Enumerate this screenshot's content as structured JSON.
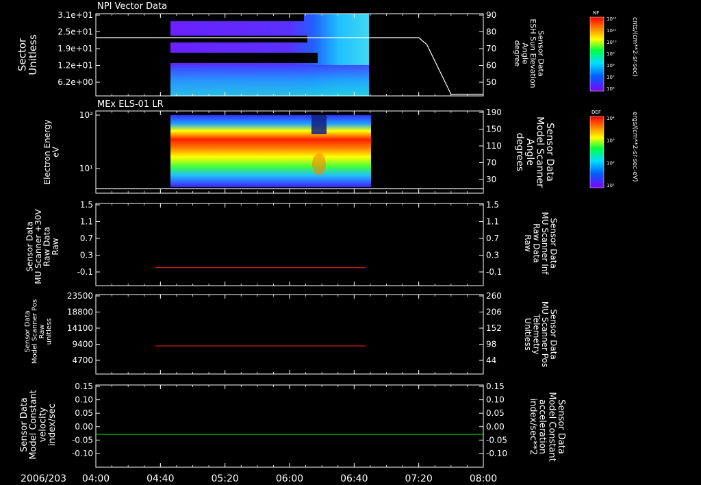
{
  "chart_data": [
    {
      "type": "heatmap",
      "title": "NPI Vector Data",
      "ylabel_left": [
        "Sector",
        "Unitless"
      ],
      "yticks_left": [
        "3.1e+01",
        "2.5e+01",
        "1.9e+01",
        "1.2e+01",
        "6.2e+00"
      ],
      "ylabel_right": [
        "Sensor Data",
        "ESH Sun Elevation",
        "Angle",
        "degree"
      ],
      "yticks_right": [
        "90",
        "80",
        "70",
        "60",
        "50"
      ],
      "ylim_right": [
        42,
        90
      ],
      "overlay_line": {
        "x": [
          "04:00",
          "06:20",
          "07:20",
          "07:25",
          "07:40",
          "08:00"
        ],
        "y": [
          76,
          76,
          76,
          72,
          43,
          43
        ]
      },
      "colorbar": {
        "label": "NF",
        "units": "cnts/(cm**2-sr-sec)",
        "ticks": [
          "10¹²",
          "10¹¹",
          "10¹⁰",
          "10⁹",
          "10⁸",
          "10⁷",
          "10⁶"
        ]
      }
    },
    {
      "type": "heatmap",
      "title": "MEx ELS-01 LR",
      "ylabel_left": [
        "Electron Energy",
        "eV"
      ],
      "yticks_left": [
        "10²",
        "10¹"
      ],
      "ylabel_right": [
        "Sensor Data",
        "Model Scanner",
        "Angle",
        "degrees"
      ],
      "yticks_right": [
        "190",
        "150",
        "110",
        "70",
        "30"
      ],
      "ylim_right": [
        0,
        190
      ],
      "overlay_line": {
        "x": [
          "04:00",
          "08:00"
        ],
        "y": [
          10,
          10
        ]
      },
      "colorbar": {
        "label": "DEF",
        "units": "ergs/(cm**2-sr-sec-eV)",
        "ticks": [
          "10⁴",
          "10³",
          "10²",
          "10¹"
        ]
      }
    },
    {
      "type": "line",
      "ylabel_left": [
        "Sensor Data",
        "MU Scanner +30V",
        "Raw Data",
        "Raw"
      ],
      "yticks_left": [
        "1.5",
        "1.1",
        "0.7",
        "0.3",
        "-0.1"
      ],
      "ylabel_right": [
        "Sensor Data",
        "MU Scanner Inf",
        "Raw Data",
        "Raw"
      ],
      "yticks_right": [
        "1.5",
        "1.1",
        "0.7",
        "0.3",
        "-0.1"
      ],
      "ylim": [
        -0.42,
        1.5
      ],
      "series": [
        {
          "color": "#ff2020",
          "x": [
            "04:37",
            "06:47"
          ],
          "y": [
            0.0,
            0.0
          ]
        }
      ]
    },
    {
      "type": "line",
      "ylabel_left": [
        "Sensor Data",
        "Model Scanner Pos",
        "Raw",
        "unitless"
      ],
      "yticks_left": [
        "23500",
        "18800",
        "14100",
        "9400",
        "4700"
      ],
      "ylabel_right": [
        "Sensor Data",
        "MU Scanner Pos",
        "Telemetry",
        "Unitless"
      ],
      "yticks_right": [
        "260",
        "206",
        "152",
        "98",
        "44"
      ],
      "ylim": [
        0,
        23500
      ],
      "series": [
        {
          "color": "#ff2020",
          "x": [
            "04:37",
            "06:47"
          ],
          "y": [
            8300,
            8300
          ]
        }
      ]
    },
    {
      "type": "line",
      "ylabel_left": [
        "Sensor Data",
        "Model Constant",
        "velocity",
        "index/sec"
      ],
      "yticks_left": [
        "0.15",
        "0.10",
        "0.05",
        "0.00",
        "-0.05",
        "-0.10"
      ],
      "ylabel_right": [
        "Sensor Data",
        "Model Constant",
        "acceleration",
        "index/sec**2"
      ],
      "yticks_right": [
        "0.15",
        "0.10",
        "0.05",
        "0.00",
        "-0.05",
        "-0.10"
      ],
      "ylim": [
        -0.1,
        0.15
      ],
      "series": [
        {
          "color": "#20e020",
          "x": [
            "04:00",
            "08:00"
          ],
          "y": [
            0.0,
            0.0
          ]
        }
      ]
    }
  ],
  "x_axis": {
    "date_label": "2006/203",
    "tick_labels": [
      "04:00",
      "04:40",
      "05:20",
      "06:00",
      "06:40",
      "07:20",
      "08:00"
    ],
    "range": [
      "04:00",
      "08:00"
    ]
  },
  "colors": {
    "red_text": "#ff2020",
    "green_text": "#20e020",
    "white": "#ffffff"
  }
}
